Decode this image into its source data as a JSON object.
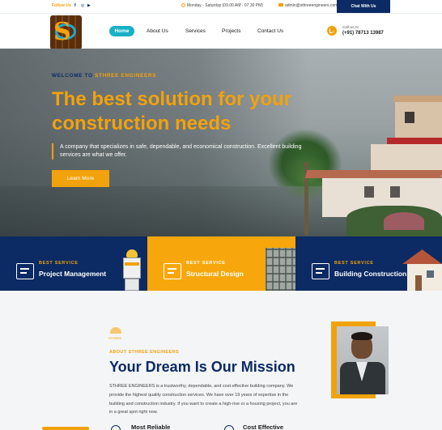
{
  "topbar": {
    "follow_label": "Follow Us",
    "social_facebook": "f",
    "social_instagram": "◎",
    "social_youtube": "▶",
    "hours": "Monday - Saturday (09.00 AM - 07.30 PM)",
    "email": "admin@sthreeengineers.com",
    "chat_label": "Chat With Us"
  },
  "nav": {
    "items": [
      {
        "label": "Home",
        "active": true
      },
      {
        "label": "About Us",
        "active": false
      },
      {
        "label": "Services",
        "active": false
      },
      {
        "label": "Projects",
        "active": false
      },
      {
        "label": "Contact Us",
        "active": false
      }
    ],
    "call_label": "Call Us At",
    "call_phone": "(+91) 78713 13987"
  },
  "hero": {
    "welcome_prefix": "WELCOME TO",
    "welcome_brand": "STHREE ENGINEERS",
    "headline": "The best solution for your construction needs",
    "tagline": "A company that specializes in safe, dependable, and economical construction. Excellent building services are what we offer.",
    "cta_label": "Learn More"
  },
  "services": [
    {
      "kicker": "BEST SERVICE",
      "title": "Project Management"
    },
    {
      "kicker": "BEST SERVICE",
      "title": "Structural Design"
    },
    {
      "kicker": "BEST SERVICE",
      "title": "Building Construction"
    }
  ],
  "about": {
    "logo_text": "STHREE",
    "kicker": "ABOUT STHREE ENGINEERS",
    "title": "Your Dream Is Our Mission",
    "body": "STHREE ENGINEERS is a trustworthy, dependable, and cost-effective building company. We provide the highest quality construction services. We have over 19 years of expertise in the building and construction industry. If you want to create a high-rise or a housing project, you are in a great spot right now.",
    "features": [
      {
        "label": "Most Reliable"
      },
      {
        "label": "Cost Effective"
      }
    ]
  },
  "colors": {
    "navy": "#0c2a63",
    "orange": "#f2a20c",
    "teal": "#18b0c4"
  }
}
